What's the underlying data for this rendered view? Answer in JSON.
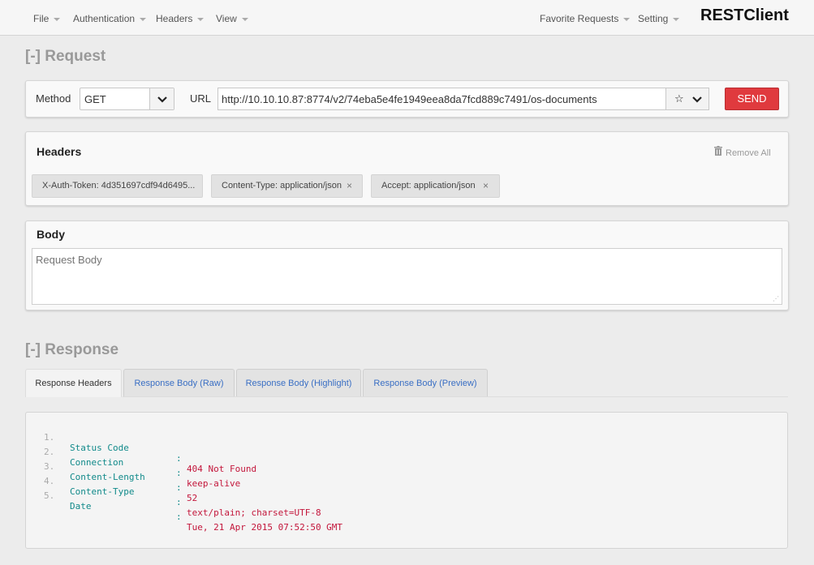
{
  "nav": {
    "menus": [
      "File",
      "Authentication",
      "Headers",
      "View"
    ],
    "right_menus": [
      "Favorite Requests",
      "Setting"
    ],
    "brand": "RESTClient"
  },
  "request": {
    "section_title": "[-] Request",
    "method_label": "Method",
    "method_value": "GET",
    "url_label": "URL",
    "url_value": "http://10.10.10.87:8774/v2/74eba5e4fe1949eea8da7fcd889c7491/os-documents",
    "send_label": "SEND",
    "star_icon": "★",
    "chevron_icon": "⌄"
  },
  "headers": {
    "title": "Headers",
    "remove_all": "Remove All",
    "chips": [
      {
        "text": "X-Auth-Token: 4d351697cdf94d6495...",
        "close": ""
      },
      {
        "text": "Content-Type: application/json",
        "close": "×"
      },
      {
        "text": "Accept: application/json",
        "close": "×"
      }
    ]
  },
  "body": {
    "title": "Body",
    "placeholder": "Request Body"
  },
  "response": {
    "section_title": "[-] Response",
    "tabs": [
      "Response Headers",
      "Response Body (Raw)",
      "Response Body (Highlight)",
      "Response Body (Preview)"
    ],
    "active_tab": "Response Headers",
    "lines": [
      {
        "num": "1.",
        "key": "Status Code",
        "sep": ":",
        "value": "404 Not Found"
      },
      {
        "num": "2.",
        "key": "Connection",
        "sep": ":",
        "value": "keep-alive"
      },
      {
        "num": "3.",
        "key": "Content-Length",
        "sep": ":",
        "value": "52"
      },
      {
        "num": "4.",
        "key": "Content-Type",
        "sep": ":",
        "value": "text/plain; charset=UTF-8"
      },
      {
        "num": "5.",
        "key": "Date",
        "sep": ":",
        "value": "Tue, 21 Apr 2015 07:52:50 GMT"
      }
    ]
  },
  "colors": {
    "send": "#e03a3e",
    "header_key": "#118a8a",
    "header_value": "#c3163b",
    "tab_link": "#3a6fc4"
  }
}
